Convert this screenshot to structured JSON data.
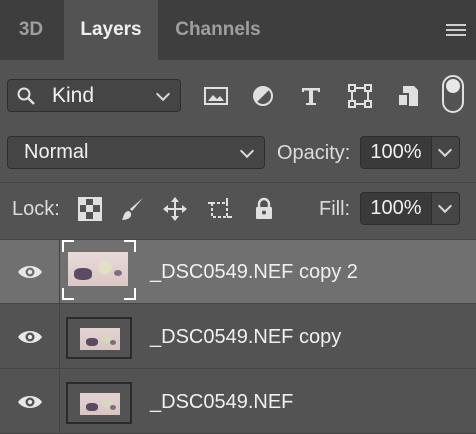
{
  "tabs": [
    {
      "label": "3D"
    },
    {
      "label": "Layers"
    },
    {
      "label": "Channels"
    }
  ],
  "filter": {
    "kind_label": "Kind",
    "icons": [
      "image-filter-icon",
      "adjustment-filter-icon",
      "type-filter-icon",
      "shape-filter-icon",
      "smart-object-filter-icon"
    ]
  },
  "blend": {
    "mode": "Normal",
    "opacity_label": "Opacity:",
    "opacity_value": "100%"
  },
  "lock": {
    "label": "Lock:",
    "fill_label": "Fill:",
    "fill_value": "100%"
  },
  "layers": [
    {
      "name": "_DSC0549.NEF copy 2",
      "visible": true,
      "selected": true
    },
    {
      "name": "_DSC0549.NEF copy",
      "visible": true,
      "selected": false
    },
    {
      "name": "_DSC0549.NEF",
      "visible": true,
      "selected": false
    }
  ],
  "colors": {
    "panel": "#535353",
    "tabbar": "#3e3e3e",
    "selected_row": "#707070"
  }
}
